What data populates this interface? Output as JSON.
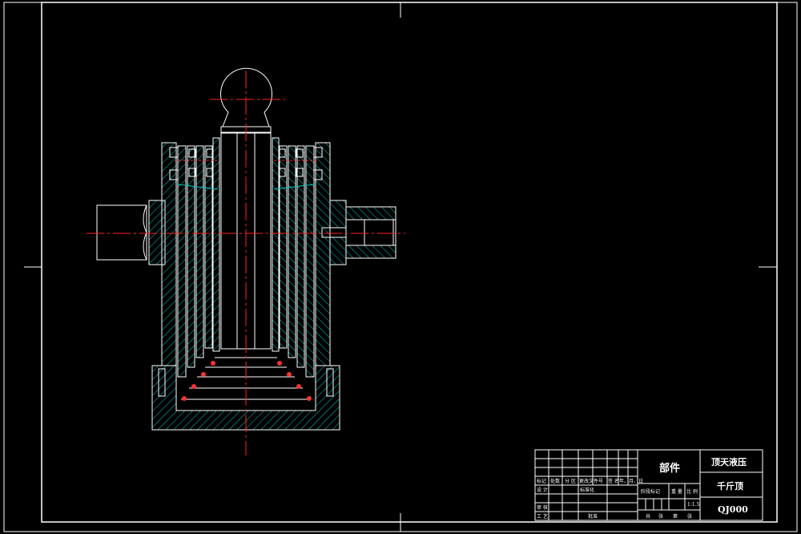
{
  "colors": {
    "background": "#000000",
    "outline": "#ffffff",
    "hatch": "#00c8c8",
    "centerline": "#ff2020",
    "seal": "#ff3030"
  },
  "title_block": {
    "part_label": "部件",
    "name_line1": "顶天液压",
    "name_line2": "千斤顶",
    "drawing_code": "QJ000",
    "scale": "1:1.5",
    "header_labels": [
      "标记",
      "处数",
      "分 区",
      "更改文件号",
      "签 名",
      "年、月、日"
    ],
    "row_labels": [
      "设 计",
      "标准化",
      "审 核",
      "工 艺",
      "批准"
    ],
    "mid_labels": [
      "阶段标记",
      "重 量",
      "比 例"
    ],
    "sheet_labels": [
      "共",
      "张",
      "第",
      "张"
    ]
  }
}
